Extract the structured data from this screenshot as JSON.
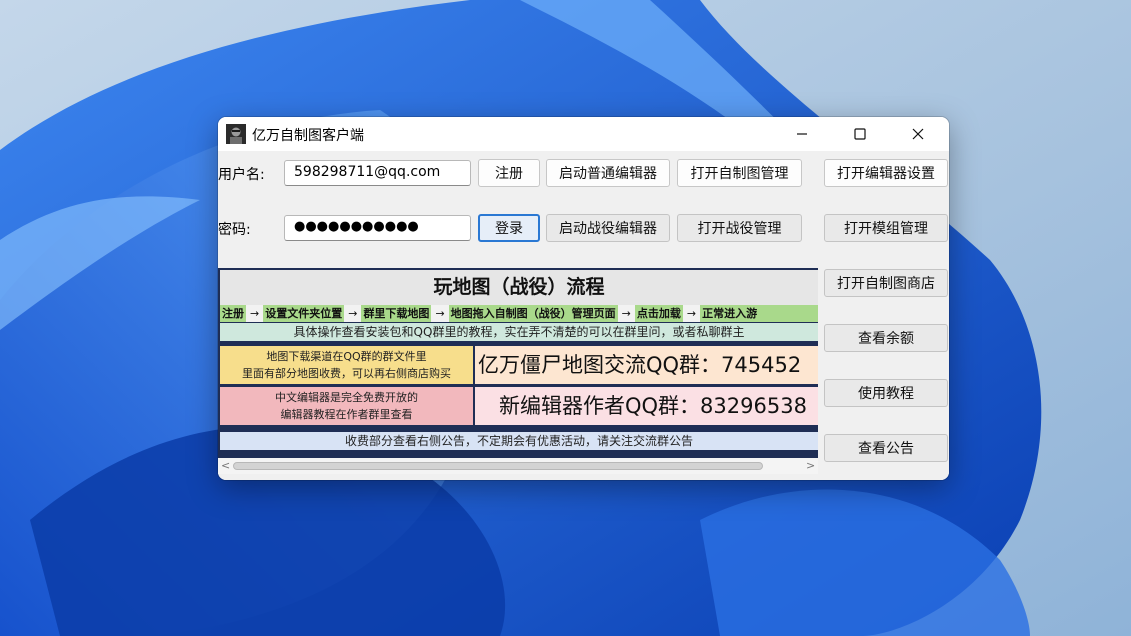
{
  "window": {
    "title": "亿万自制图客户端",
    "controls": {
      "minimize": "minimize",
      "maximize": "maximize",
      "close": "close"
    }
  },
  "form": {
    "username_label": "用户名:",
    "username_value": "598298711@qq.com",
    "password_label": "密码:",
    "password_value": "●●●●●●●●●●●",
    "register_label": "注册",
    "login_label": "登录"
  },
  "buttons": {
    "start_normal_editor": "启动普通编辑器",
    "open_custom_map_manager": "打开自制图管理",
    "open_editor_settings": "打开编辑器设置",
    "start_campaign_editor": "启动战役编辑器",
    "open_campaign_manager": "打开战役管理",
    "open_mod_manager": "打开模组管理",
    "open_custom_map_store": "打开自制图商店",
    "check_balance": "查看余额",
    "tutorial": "使用教程",
    "announcements": "查看公告"
  },
  "banner": {
    "title": "玩地图（战役）流程",
    "steps": [
      "注册",
      "设置文件夹位置",
      "群里下载地图",
      "地图拖入自制图（战役）管理页面",
      "点击加载",
      "正常进入游"
    ],
    "step_arrow": "→",
    "help_text": "具体操作查看安装包和QQ群里的教程，实在弄不清楚的可以在群里问，或者私聊群主",
    "download_note_line1": "地图下载渠道在QQ群的群文件里",
    "download_note_line2": "里面有部分地图收费，可以再右侧商店购买",
    "qq_group_map": "亿万僵尸地图交流QQ群：745452",
    "editor_note_line1": "中文编辑器是完全免费开放的",
    "editor_note_line2": "编辑器教程在作者群里查看",
    "qq_group_editor": "新编辑器作者QQ群：83296538",
    "footer": "收费部分查看右侧公告，不定期会有优惠活动，请关注交流群公告"
  },
  "scrollbar": {
    "left_arrow": "<",
    "right_arrow": ">"
  },
  "colors": {
    "accent": "#2a78d3",
    "wallpaper": "#1a5fd6"
  }
}
